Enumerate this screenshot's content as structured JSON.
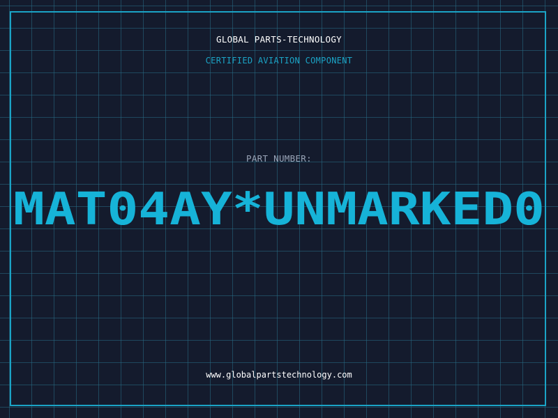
{
  "header": {
    "company": "GLOBAL PARTS-TECHNOLOGY",
    "subtitle": "CERTIFIED AVIATION COMPONENT"
  },
  "part": {
    "label": "PART NUMBER:",
    "value": "MAT04AY*UNMARKED0"
  },
  "footer": {
    "url": "www.globalpartstechnology.com"
  },
  "colors": {
    "background": "#141b2d",
    "grid": "#286e87",
    "accent": "#1ba4c6",
    "text": "#ffffff",
    "muted": "#9aa5b8"
  }
}
